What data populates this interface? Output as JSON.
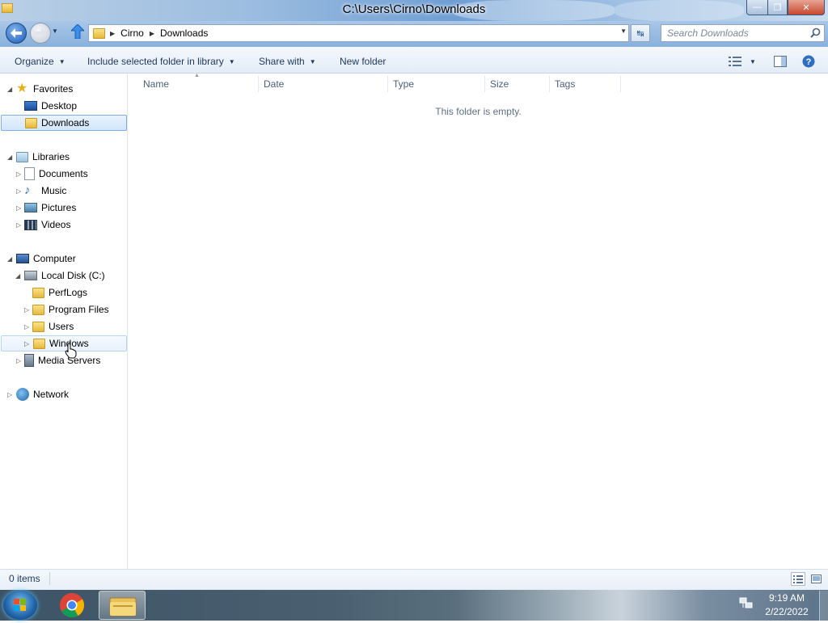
{
  "window": {
    "title": "C:\\Users\\Cirno\\Downloads",
    "minimize_glyph": "—",
    "maximize_glyph": "❐",
    "close_glyph": "✕"
  },
  "nav": {
    "breadcrumb": [
      "Cirno",
      "Downloads"
    ],
    "search_placeholder": "Search Downloads"
  },
  "toolbar": {
    "organize": "Organize",
    "include_library": "Include selected folder in library",
    "share_with": "Share with",
    "new_folder": "New folder"
  },
  "sidebar": {
    "favorites": {
      "label": "Favorites",
      "items": [
        "Desktop",
        "Downloads"
      ]
    },
    "libraries": {
      "label": "Libraries",
      "items": [
        "Documents",
        "Music",
        "Pictures",
        "Videos"
      ]
    },
    "computer": {
      "label": "Computer",
      "local_disk": "Local Disk (C:)",
      "folders": [
        "PerfLogs",
        "Program Files",
        "Users",
        "Windows"
      ],
      "media_servers": "Media Servers"
    },
    "network": {
      "label": "Network"
    },
    "selected": "Downloads",
    "hovered": "Windows"
  },
  "columns": [
    "Name",
    "Date",
    "Type",
    "Size",
    "Tags"
  ],
  "empty_message": "This folder is empty.",
  "status": {
    "item_count": "0 items"
  },
  "taskbar": {
    "time": "9:19 AM",
    "date": "2/22/2022"
  },
  "colors": {
    "accent": "#1e395b",
    "selection_border": "#84acdd",
    "folder": "#e6b83b"
  }
}
